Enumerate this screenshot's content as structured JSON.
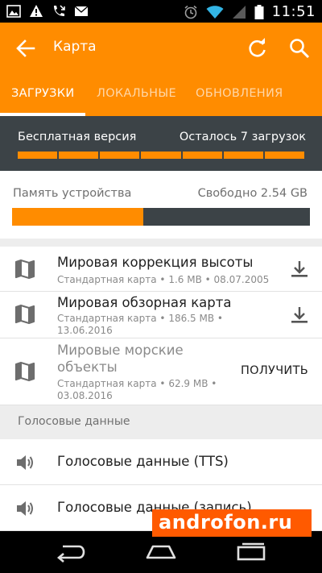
{
  "status_bar": {
    "time": "11:51"
  },
  "app_bar": {
    "title": "Карта"
  },
  "tabs": [
    {
      "label": "ЗАГРУЗКИ",
      "active": true
    },
    {
      "label": "ЛОКАЛЬНЫЕ",
      "active": false
    },
    {
      "label": "ОБНОВЛЕНИЯ",
      "active": false
    }
  ],
  "free_version": {
    "label": "Бесплатная версия",
    "remaining": "Осталось 7 загрузок",
    "segments_total": 7,
    "segments_filled": 7
  },
  "memory": {
    "label": "Память устройства",
    "free": "Свободно 2.54 GB",
    "used_fraction": 0.44
  },
  "maps": [
    {
      "name": "Мировая коррекция высоты",
      "meta": "Стандартная карта • 1.6 MB • 08.07.2005",
      "action": "download-icon"
    },
    {
      "name": "Мировая обзорная карта",
      "meta_line1": "Стандартная карта • 186.5 MB •",
      "meta_line2": "13.06.2016",
      "action": "download-icon"
    },
    {
      "name_line1": "Мировые морские",
      "name_line2": "объекты",
      "meta_line1": "Стандартная карта • 62.9 MB •",
      "meta_line2": "03.08.2016",
      "action_label": "ПОЛУЧИТЬ"
    }
  ],
  "voice_section": {
    "header": "Голосовые данные",
    "items": [
      {
        "name": "Голосовые данные (TTS)"
      },
      {
        "name": "Голосовые данные (запись)"
      }
    ]
  },
  "watermark": {
    "text": "androfon.ru"
  },
  "colors": {
    "accent": "#ff8c00",
    "dark_panel": "#3c4347",
    "watermark": "#ff5a00"
  }
}
